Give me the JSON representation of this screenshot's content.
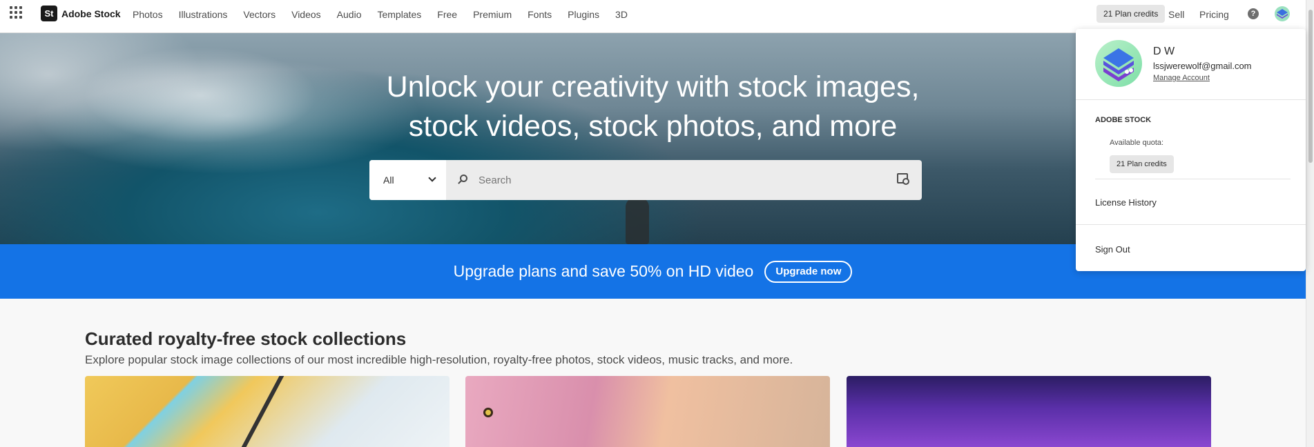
{
  "topnav": {
    "apps_icon": "grid-icon",
    "logo_mark": "St",
    "logo_text": "Adobe Stock",
    "links": [
      "Photos",
      "Illustrations",
      "Vectors",
      "Videos",
      "Audio",
      "Templates",
      "Free",
      "Premium",
      "Fonts",
      "Plugins",
      "3D"
    ],
    "plan_credits": "21 Plan credits",
    "sell": "Sell",
    "pricing": "Pricing",
    "help_icon_glyph": "?"
  },
  "hero": {
    "title_line1": "Unlock your creativity with stock images,",
    "title_line2": "stock videos, stock photos, and more",
    "search_type": "All",
    "search_placeholder": "Search"
  },
  "promo": {
    "text": "Upgrade plans and save 50% on HD video",
    "button": "Upgrade now",
    "color": "#1473e6"
  },
  "collections": {
    "title": "Curated royalty-free stock collections",
    "subtitle": "Explore popular stock image collections of our most incredible high-resolution, royalty-free photos, stock videos, music tracks, and more."
  },
  "account": {
    "name": "D W",
    "email": "lssjwerewolf@gmail.com",
    "manage": "Manage Account",
    "section": "ADOBE STOCK",
    "quota_label": "Available quota:",
    "quota_value": "21 Plan credits",
    "license_history": "License History",
    "sign_out": "Sign Out"
  }
}
